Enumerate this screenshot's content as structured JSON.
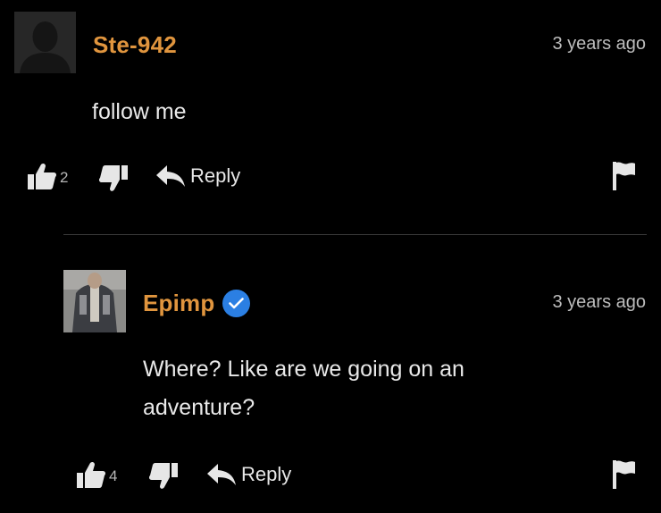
{
  "comments": [
    {
      "username": "Ste-942",
      "timestamp": "3 years ago",
      "text": "follow me",
      "likes": "2",
      "reply_label": "Reply",
      "verified": false
    },
    {
      "username": "Epimp",
      "timestamp": "3 years ago",
      "text": "Where? Like are we going on an adventure?",
      "likes": "4",
      "reply_label": "Reply",
      "verified": true
    }
  ],
  "colors": {
    "background": "#000000",
    "username": "#e0953e",
    "verified_badge": "#2b7fe3"
  },
  "icons": [
    "thumbs-up-icon",
    "thumbs-down-icon",
    "reply-arrow-icon",
    "flag-icon",
    "verified-badge-icon"
  ]
}
